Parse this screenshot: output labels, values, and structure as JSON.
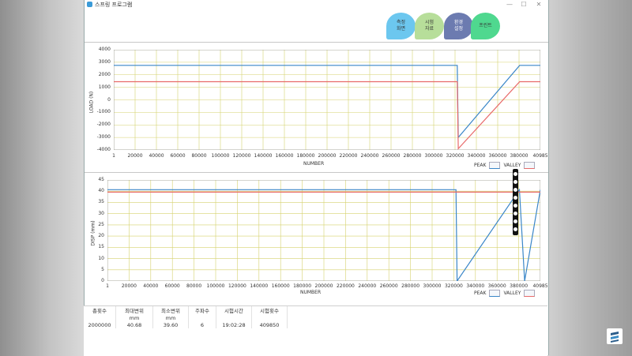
{
  "window": {
    "title": "스프링 프로그램"
  },
  "controls": {
    "minimize": "—",
    "maximize": "☐",
    "close": "✕"
  },
  "nav": [
    {
      "line1": "측정",
      "line2": "화면",
      "color": "#6cc7ef"
    },
    {
      "line1": "시험",
      "line2": "자료",
      "color": "#b7de9a"
    },
    {
      "line1": "환경",
      "line2": "설정",
      "color": "#6c7bb0"
    },
    {
      "line1": "프린트",
      "line2": "",
      "color": "#4fd88f"
    }
  ],
  "chart_data": [
    {
      "type": "line",
      "ylabel": "LOAD (N)",
      "xlabel": "NUMBER",
      "xlim": [
        1,
        409850
      ],
      "ylim": [
        -4000,
        4000
      ],
      "x_ticks": [
        "1",
        "20000",
        "40000",
        "60000",
        "80000",
        "100000",
        "120000",
        "140000",
        "160000",
        "180000",
        "200000",
        "220000",
        "240000",
        "260000",
        "280000",
        "300000",
        "320000",
        "340000",
        "360000",
        "380000",
        "40985"
      ],
      "y_ticks": [
        "4000",
        "3000",
        "2000",
        "1000",
        "0",
        "-1000",
        "-2000",
        "-3000",
        "-4000"
      ],
      "legend": [
        "PEAK",
        "VALLEY"
      ],
      "series": [
        {
          "name": "PEAK",
          "color": "#3a86c8",
          "x": [
            1,
            8000,
            16000,
            215000,
            272000,
            330000,
            331000,
            390000,
            395000,
            409850
          ],
          "y": [
            2750,
            2750,
            2750,
            2750,
            2750,
            2750,
            -3000,
            2750,
            2750,
            2750
          ]
        },
        {
          "name": "VALLEY",
          "color": "#e86a6a",
          "x": [
            1,
            8000,
            16000,
            215000,
            272000,
            330000,
            331000,
            390000,
            395000,
            409850
          ],
          "y": [
            1450,
            1450,
            1450,
            1450,
            1450,
            1450,
            -3900,
            1450,
            1450,
            1450
          ]
        }
      ]
    },
    {
      "type": "line",
      "ylabel": "DISP (mm)",
      "xlabel": "NUMBER",
      "xlim": [
        1,
        409850
      ],
      "ylim": [
        0,
        45
      ],
      "x_ticks": [
        "1",
        "20000",
        "40000",
        "60000",
        "80000",
        "100000",
        "120000",
        "140000",
        "160000",
        "180000",
        "200000",
        "220000",
        "240000",
        "260000",
        "280000",
        "300000",
        "320000",
        "340000",
        "360000",
        "380000",
        "40985"
      ],
      "y_ticks": [
        "45",
        "40",
        "35",
        "30",
        "25",
        "20",
        "15",
        "10",
        "5",
        "0"
      ],
      "legend": [
        "PEAK",
        "VALLEY"
      ],
      "series": [
        {
          "name": "PEAK",
          "color": "#3a86c8",
          "x": [
            1,
            330000,
            331000,
            390000,
            395000,
            409850
          ],
          "y": [
            40.68,
            40.68,
            0,
            40.68,
            0,
            40.68
          ]
        },
        {
          "name": "VALLEY",
          "color": "#e86a6a",
          "x": [
            1,
            409850
          ],
          "y": [
            39.6,
            39.6
          ]
        }
      ]
    }
  ],
  "summary": {
    "headers": [
      "총횟수",
      "최대변위",
      "최소변위",
      "주파수",
      "시험시간",
      "시험횟수"
    ],
    "units": [
      "",
      "mm",
      "mm",
      "",
      "",
      ""
    ],
    "values": [
      "2000000",
      "40.68",
      "39.60",
      "6",
      "19:02:28",
      "409850"
    ]
  }
}
